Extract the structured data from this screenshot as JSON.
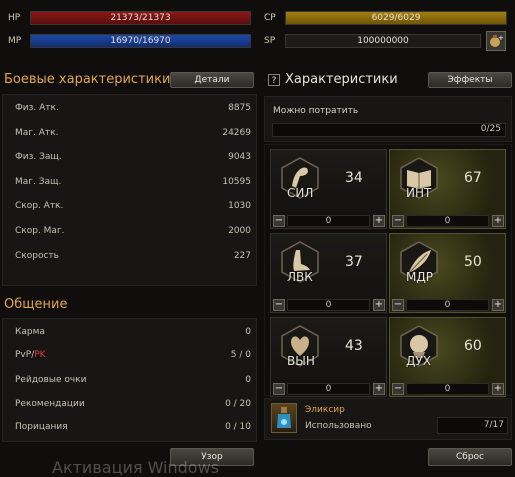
{
  "top": {
    "hp": {
      "label": "HP",
      "value": "21373/21373",
      "fill": 1.0
    },
    "mp": {
      "label": "MP",
      "value": "16970/16970",
      "fill": 1.0
    },
    "cp": {
      "label": "CP",
      "value": "6029/6029",
      "fill": 1.0
    },
    "sp": {
      "label": "SP",
      "value": "100000000"
    }
  },
  "combat": {
    "title": "Боевые характеристики",
    "details_button": "Детали",
    "rows": [
      {
        "label": "Физ. Атк.",
        "value": "8875"
      },
      {
        "label": "Маг. Атк.",
        "value": "24269"
      },
      {
        "label": "Физ. Защ.",
        "value": "9043"
      },
      {
        "label": "Маг. Защ.",
        "value": "10595"
      },
      {
        "label": "Скор. Атк.",
        "value": "1030"
      },
      {
        "label": "Скор. Маг.",
        "value": "2000"
      },
      {
        "label": "Скорость",
        "value": "227"
      }
    ]
  },
  "social": {
    "title": "Общение",
    "rows": [
      {
        "label": "Карма",
        "value": "0"
      },
      {
        "label_pvp": "PvP",
        "label_sep": "/",
        "label_pk": "PK",
        "value": "5 / 0"
      },
      {
        "label": "Рейдовые очки",
        "value": "0"
      },
      {
        "label": "Рекомендации",
        "value": "0 / 20"
      },
      {
        "label": "Порицания",
        "value": "0 / 10"
      }
    ],
    "pattern_button": "Узор"
  },
  "stats": {
    "title": "Характеристики",
    "help_icon": "?",
    "effects_button": "Эффекты",
    "spend_label": "Можно потратить",
    "spend_value": "0/25",
    "cards": [
      {
        "abbr": "СИЛ",
        "value": "34",
        "alloc": "0",
        "icon": "arm-icon"
      },
      {
        "abbr": "ИНТ",
        "value": "67",
        "alloc": "0",
        "icon": "book-icon"
      },
      {
        "abbr": "ЛВК",
        "value": "37",
        "alloc": "0",
        "icon": "foot-icon"
      },
      {
        "abbr": "МДР",
        "value": "50",
        "alloc": "0",
        "icon": "feather-icon"
      },
      {
        "abbr": "ВЫН",
        "value": "43",
        "alloc": "0",
        "icon": "heart-icon"
      },
      {
        "abbr": "ДУХ",
        "value": "60",
        "alloc": "0",
        "icon": "mind-icon"
      }
    ],
    "elixir_title": "Эликсир",
    "elixir_used_label": "Использовано",
    "elixir_used_value": "7/17",
    "reset_button": "Сброс"
  },
  "watermark": "Активация Windows",
  "colors": {
    "accent": "#e3a550",
    "pk": "#e03c3c"
  }
}
